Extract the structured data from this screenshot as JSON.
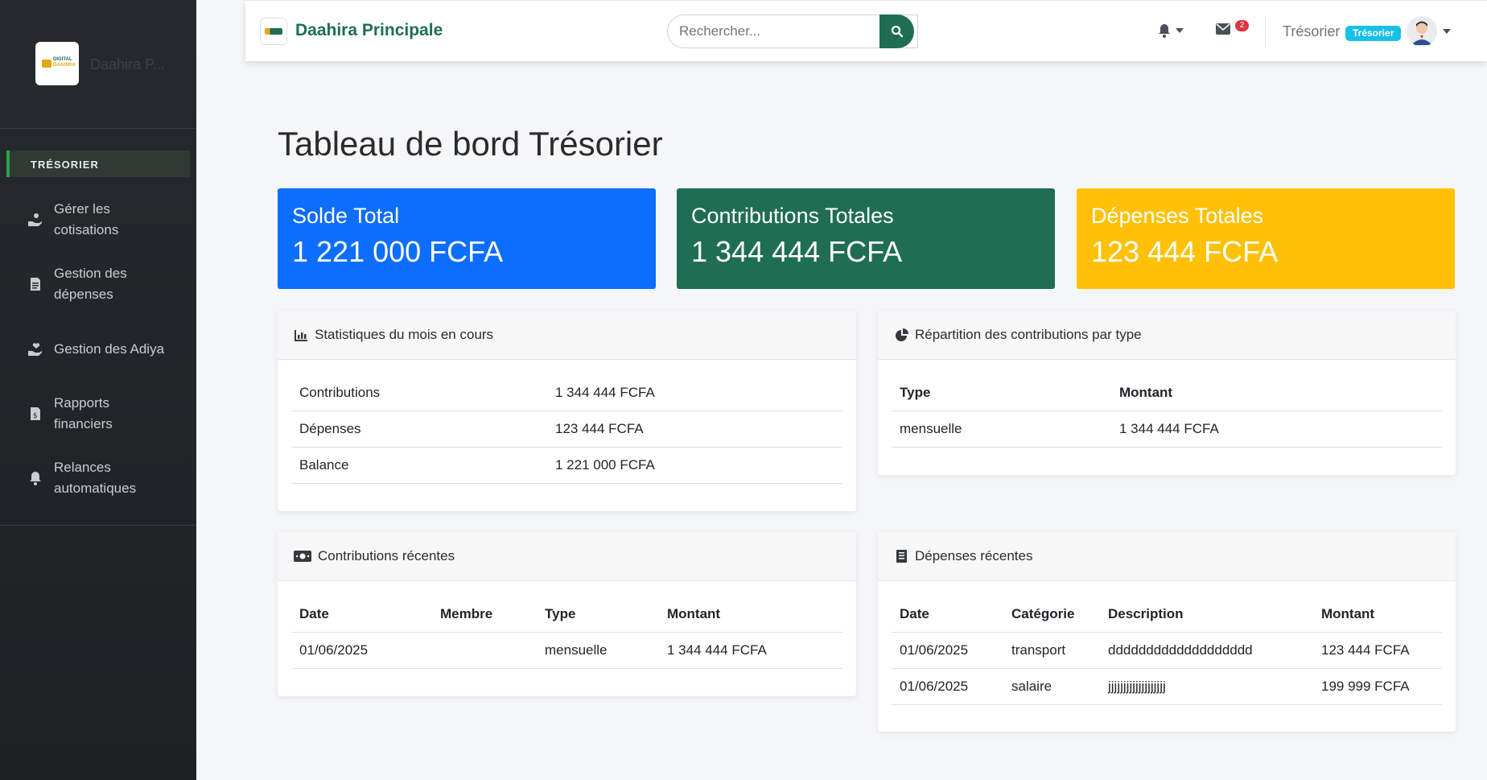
{
  "sidebar": {
    "brand_name": "Daahira P...",
    "logo_text_1": "DIGITAL",
    "logo_text_2": "DAAHIRA",
    "section": "TRÉSORIER",
    "items": [
      {
        "label": "Gérer les cotisations",
        "icon": "hand-coins-icon"
      },
      {
        "label": "Gestion des dépenses",
        "icon": "receipt-icon"
      },
      {
        "label": "Gestion des Adiya",
        "icon": "hand-heart-icon"
      },
      {
        "label": "Rapports financiers",
        "icon": "file-invoice-icon"
      },
      {
        "label": "Relances automatiques",
        "icon": "bell-icon"
      }
    ]
  },
  "topbar": {
    "title": "Daahira Principale",
    "search_placeholder": "Rechercher...",
    "mail_badge": "2",
    "user_name": "Trésorier",
    "role_badge": "Trésorier"
  },
  "main": {
    "page_title": "Tableau de bord Trésorier",
    "stats": [
      {
        "label": "Solde Total",
        "value": "1 221 000 FCFA",
        "color": "#0d6efd"
      },
      {
        "label": "Contributions Totales",
        "value": "1 344 444 FCFA",
        "color": "#1f6e54"
      },
      {
        "label": "Dépenses Totales",
        "value": "123 444 FCFA",
        "color": "#ffc107"
      }
    ],
    "stats_month": {
      "title": "Statistiques du mois en cours",
      "rows": [
        {
          "label": "Contributions",
          "value": "1 344 444 FCFA"
        },
        {
          "label": "Dépenses",
          "value": "123 444 FCFA"
        },
        {
          "label": "Balance",
          "value": "1 221 000 FCFA"
        }
      ]
    },
    "repartition": {
      "title": "Répartition des contributions par type",
      "headers": [
        "Type",
        "Montant"
      ],
      "rows": [
        [
          "mensuelle",
          "1 344 444 FCFA"
        ]
      ]
    },
    "recent_contributions": {
      "title": "Contributions récentes",
      "headers": [
        "Date",
        "Membre",
        "Type",
        "Montant"
      ],
      "rows": [
        [
          "01/06/2025",
          "",
          "mensuelle",
          "1 344 444 FCFA"
        ]
      ]
    },
    "recent_expenses": {
      "title": "Dépenses récentes",
      "headers": [
        "Date",
        "Catégorie",
        "Description",
        "Montant"
      ],
      "rows": [
        [
          "01/06/2025",
          "transport",
          "ddddddddddddddddddd",
          "123 444 FCFA"
        ],
        [
          "01/06/2025",
          "salaire",
          "jjjjjjjjjjjjjjjjjjj",
          "199 999 FCFA"
        ]
      ]
    }
  }
}
